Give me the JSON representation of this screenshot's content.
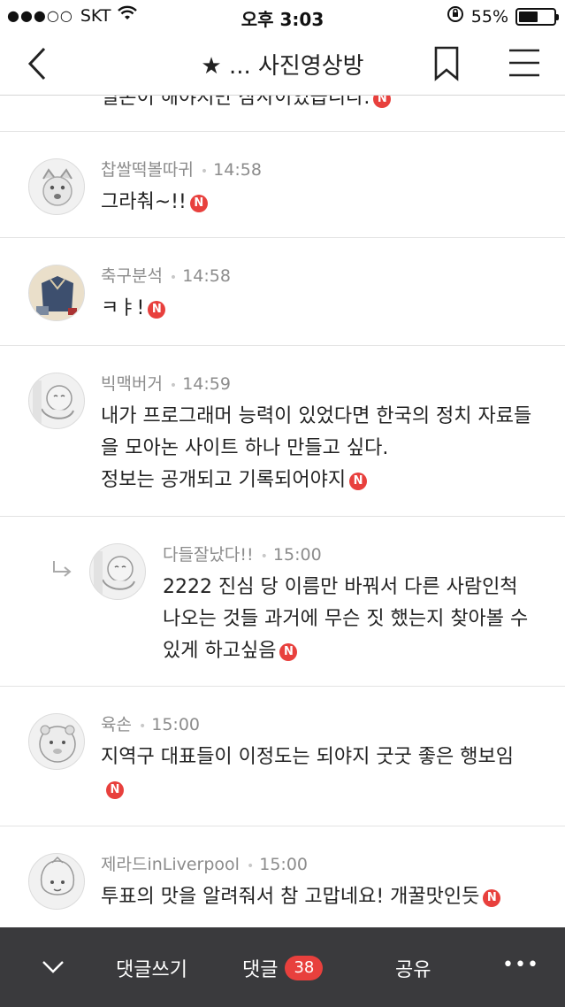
{
  "status_bar": {
    "carrier": "SKT",
    "signal": "●●●○○",
    "time": "오후 3:03",
    "battery": "55%",
    "battery_level": 0.55
  },
  "nav": {
    "title": "★ ... 사진영상방"
  },
  "clipped_text": "일본이 해야지만 삼사이었습니다.",
  "comments": [
    {
      "author": "찹쌀떡볼따귀",
      "time": "14:58",
      "lines": [
        "그라춰~!!"
      ],
      "new_badge": "N"
    },
    {
      "author": "축구분석",
      "time": "14:58",
      "lines": [
        "ㅋㅑ!"
      ],
      "new_badge": "N"
    },
    {
      "author": "빅맥버거",
      "time": "14:59",
      "lines": [
        "내가 프로그래머 능력이 있었다면 한국의 정치 자료들",
        "을 모아논 사이트 하나 만들고 싶다.",
        "정보는 공개되고 기록되어야지"
      ],
      "new_badge": "N"
    },
    {
      "author": "다들잘났다!!",
      "time": "15:00",
      "lines": [
        "2222 진심 당 이름만 바꿔서 다른 사람인척",
        "나오는 것들 과거에 무슨 짓 했는지 찾아볼 수",
        "있게 하고싶음"
      ],
      "new_badge": "N",
      "is_reply": true
    },
    {
      "author": "육손",
      "time": "15:00",
      "lines": [
        "지역구 대표들이 이정도는 되야지 굿굿 좋은 행보임",
        ""
      ],
      "new_badge": "N"
    },
    {
      "author": "제라드inLiverpool",
      "time": "15:00",
      "lines": [
        "투표의 맛을 알려줘서 참 고맙네요! 개꿀맛인듯"
      ],
      "new_badge": "N"
    }
  ],
  "bottom_bar": {
    "write_label": "댓글쓰기",
    "comments_label": "댓글",
    "comments_count": "38",
    "share_label": "공유",
    "more_label": "•••"
  },
  "colors": {
    "badge": "#e8403d",
    "bottom_bar": "#3a3a3d",
    "meta_text": "#8c8c8c"
  }
}
